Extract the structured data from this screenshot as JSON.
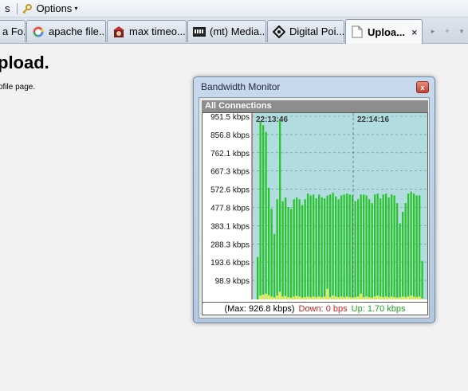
{
  "menubar": {
    "partial_item": "s",
    "options_label": "Options",
    "options_arrow": "▾"
  },
  "tabs": [
    {
      "label": "a Fo...",
      "icon": "generic-page-icon"
    },
    {
      "label": "apache file...",
      "icon": "google-icon"
    },
    {
      "label": "max timeo...",
      "icon": "site-icon"
    },
    {
      "label": "(mt) Media...",
      "icon": "mediatemple-icon"
    },
    {
      "label": "Digital Poi...",
      "icon": "digitalpoint-icon"
    },
    {
      "label": "Uploa...",
      "icon": "blank-page-icon",
      "active": true
    }
  ],
  "tab_close": "×",
  "tabstrip_buttons": {
    "scroll": "▸",
    "add": "+",
    "list": "▾"
  },
  "page": {
    "title": "pload.",
    "text": "ofile page."
  },
  "monitor": {
    "title": "Bandwidth Monitor",
    "close_glyph": "x",
    "section": "All Connections",
    "time_labels": [
      "22:13:46",
      "22:14:16"
    ],
    "footer_max": "(Max: 926.8 kbps)",
    "footer_down": "Down: 0 bps",
    "footer_up": "Up: 1.70 kbps",
    "colors": {
      "down": "#2bc42b",
      "up": "#f2ef3a",
      "plot_bg": "#b2dde0",
      "grid": "#5f8d92"
    }
  },
  "chart_data": {
    "type": "bar",
    "title": "All Connections",
    "ylabel": "kbps",
    "yticks": [
      "951.5 kbps",
      "856.8 kbps",
      "762.1 kbps",
      "667.3 kbps",
      "572.6 kbps",
      "477.8 kbps",
      "383.1 kbps",
      "288.3 kbps",
      "193.6 kbps",
      "98.9 kbps"
    ],
    "ytick_values": [
      951.5,
      856.8,
      762.1,
      667.3,
      572.6,
      477.8,
      383.1,
      288.3,
      193.6,
      98.9
    ],
    "ylim": [
      0,
      951.5
    ],
    "xlabels": [
      "22:13:46",
      "22:14:16"
    ],
    "grid": true,
    "series": [
      {
        "name": "Down",
        "values": [
          220,
          925,
          905,
          870,
          580,
          470,
          340,
          520,
          935,
          510,
          530,
          480,
          470,
          520,
          530,
          520,
          490,
          520,
          550,
          540,
          545,
          525,
          545,
          530,
          525,
          540,
          545,
          555,
          535,
          520,
          540,
          545,
          550,
          545,
          540,
          510,
          520,
          545,
          545,
          540,
          520,
          500,
          545,
          550,
          525,
          545,
          550,
          530,
          545,
          540,
          500,
          395,
          455,
          500,
          550,
          560,
          550,
          540,
          540,
          200
        ]
      },
      {
        "name": "Up",
        "values": [
          0,
          20,
          25,
          30,
          22,
          15,
          10,
          20,
          40,
          15,
          18,
          12,
          10,
          15,
          18,
          15,
          10,
          12,
          15,
          12,
          15,
          12,
          15,
          12,
          15,
          55,
          12,
          20,
          15,
          12,
          15,
          12,
          15,
          12,
          10,
          12,
          15,
          30,
          12,
          15,
          12,
          10,
          15,
          20,
          15,
          12,
          15,
          12,
          15,
          12,
          10,
          12,
          15,
          12,
          15,
          20,
          15,
          12,
          15,
          5
        ]
      }
    ]
  }
}
